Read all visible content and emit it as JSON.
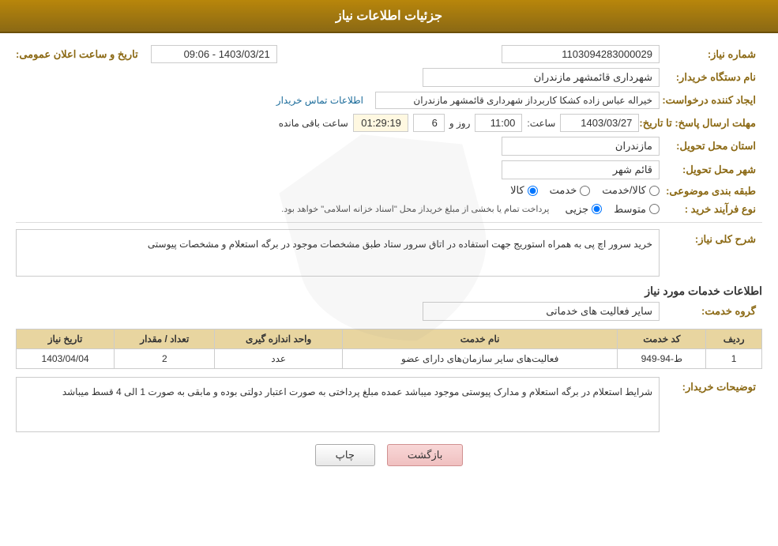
{
  "header": {
    "title": "جزئیات اطلاعات نیاز"
  },
  "fields": {
    "request_number_label": "شماره نیاز:",
    "request_number_value": "1103094283000029",
    "org_name_label": "نام دستگاه خریدار:",
    "org_name_value": "شهرداری قائمشهر مازندران",
    "announce_datetime_label": "تاریخ و ساعت اعلان عمومی:",
    "announce_datetime_value": "1403/03/21 - 09:06",
    "creator_label": "ایجاد کننده درخواست:",
    "creator_value": "خیراله عباس زاده کشکا کاربرداز شهرداری قائمشهر مازندران",
    "contact_link_text": "اطلاعات تماس خریدار",
    "deadline_label": "مهلت ارسال پاسخ: تا تاریخ:",
    "deadline_date": "1403/03/27",
    "deadline_time_label": "ساعت:",
    "deadline_time_value": "11:00",
    "deadline_day_label": "روز و",
    "deadline_day_value": "6",
    "deadline_remaining_label": "ساعت باقی مانده",
    "deadline_remaining_value": "01:29:19",
    "province_label": "استان محل تحویل:",
    "province_value": "مازندران",
    "city_label": "شهر محل تحویل:",
    "city_value": "قائم شهر",
    "category_label": "طبقه بندی موضوعی:",
    "category_options": [
      "کالا",
      "خدمت",
      "کالا/خدمت"
    ],
    "category_selected": "کالا",
    "process_label": "نوع فرآیند خرید :",
    "process_options": [
      "جزیی",
      "متوسط"
    ],
    "process_note": "پرداخت تمام یا بخشی از مبلغ خریداز محل \"اسناد خزانه اسلامی\" خواهد بود.",
    "description_label": "شرح کلی نیاز:",
    "description_value": "خرید سرور اچ پی به همراه استوریج جهت استفاده در اتاق سرور ستاد طبق مشخصات موجود در برگه استعلام\nو مشخصات پیوستی",
    "services_section_label": "اطلاعات خدمات مورد نیاز",
    "service_group_label": "گروه خدمت:",
    "service_group_value": "سایر فعالیت های خدماتی",
    "services_table": {
      "headers": [
        "ردیف",
        "کد خدمت",
        "نام خدمت",
        "واحد اندازه گیری",
        "تعداد / مقدار",
        "تاریخ نیاز"
      ],
      "rows": [
        {
          "row_num": "1",
          "service_code": "ط-94-949",
          "service_name": "فعالیت‌های سایر سازمان‌های دارای عضو",
          "unit": "عدد",
          "quantity": "2",
          "date": "1403/04/04"
        }
      ]
    },
    "buyer_desc_label": "توضیحات خریدار:",
    "buyer_desc_value": "شرایط استعلام در برگه استعلام و مدارک پیوستی موجود میباشد\nعمده مبلغ پرداختی به صورت اعتبار دولتی بوده و مابقی به صورت 1 الی 4 قسط میباشد"
  },
  "buttons": {
    "print_label": "چاپ",
    "back_label": "بازگشت"
  }
}
